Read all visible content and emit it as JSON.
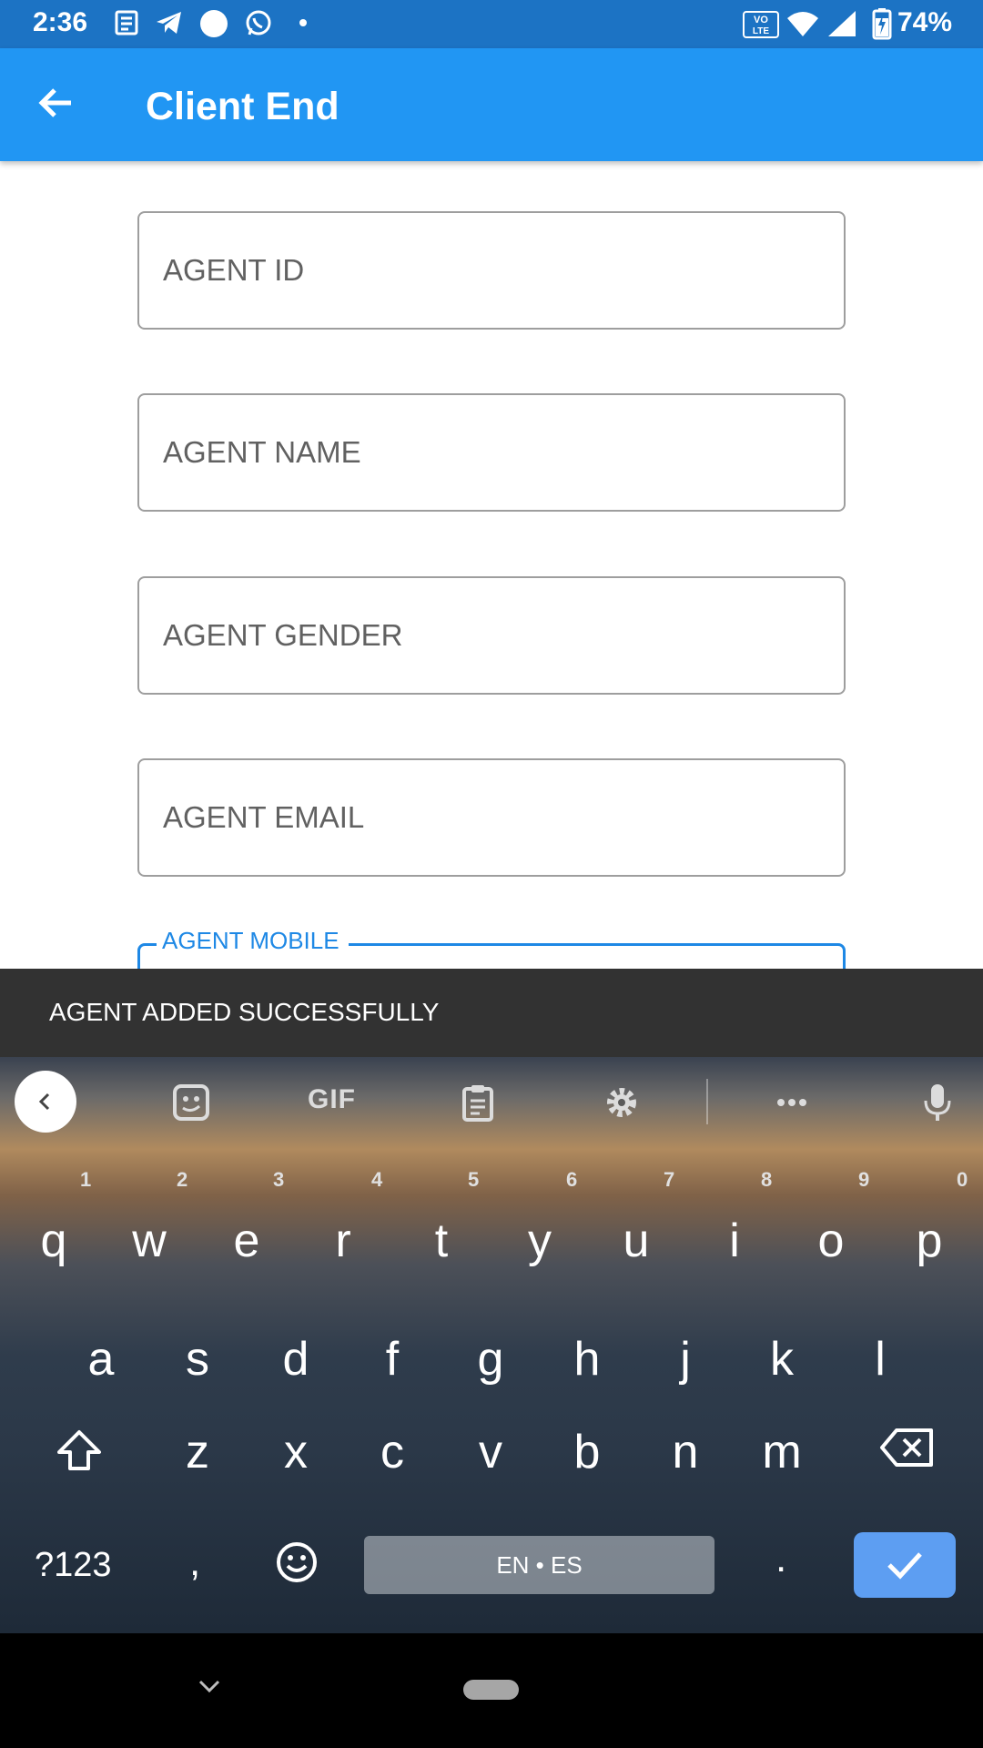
{
  "status_bar": {
    "time": "2:36",
    "battery": "74%",
    "icons": [
      "news-icon",
      "telegram-icon",
      "circle-icon",
      "whatsapp-icon",
      "dot-icon",
      "volte-icon",
      "wifi-icon",
      "signal-icon",
      "battery-charging-icon"
    ]
  },
  "app_bar": {
    "title": "Client End",
    "back_icon": "arrow-back-icon",
    "color": "#2196f3"
  },
  "form": {
    "fields": [
      {
        "label": "AGENT ID"
      },
      {
        "label": "AGENT NAME"
      },
      {
        "label": "AGENT GENDER"
      },
      {
        "label": "AGENT EMAIL"
      }
    ],
    "focused_field_label": "AGENT MOBILE"
  },
  "snackbar": {
    "message": "AGENT ADDED SUCCESSFULLY"
  },
  "keyboard": {
    "toolbar": {
      "gif_label": "GIF",
      "icons": [
        "collapse-icon",
        "sticker-icon",
        "clipboard-icon",
        "settings-icon",
        "more-icon",
        "mic-icon"
      ]
    },
    "row1": [
      {
        "key": "q",
        "hint": "1"
      },
      {
        "key": "w",
        "hint": "2"
      },
      {
        "key": "e",
        "hint": "3"
      },
      {
        "key": "r",
        "hint": "4"
      },
      {
        "key": "t",
        "hint": "5"
      },
      {
        "key": "y",
        "hint": "6"
      },
      {
        "key": "u",
        "hint": "7"
      },
      {
        "key": "i",
        "hint": "8"
      },
      {
        "key": "o",
        "hint": "9"
      },
      {
        "key": "p",
        "hint": "0"
      }
    ],
    "row2": [
      "a",
      "s",
      "d",
      "f",
      "g",
      "h",
      "j",
      "k",
      "l"
    ],
    "row3": [
      "z",
      "x",
      "c",
      "v",
      "b",
      "n",
      "m"
    ],
    "symbols_label": "?123",
    "comma": ",",
    "period": ".",
    "space_label": "EN • ES",
    "enter_color": "#5d9ef2"
  },
  "nav_bar": {
    "icons": [
      "nav-down-icon",
      "home-pill-icon"
    ]
  }
}
